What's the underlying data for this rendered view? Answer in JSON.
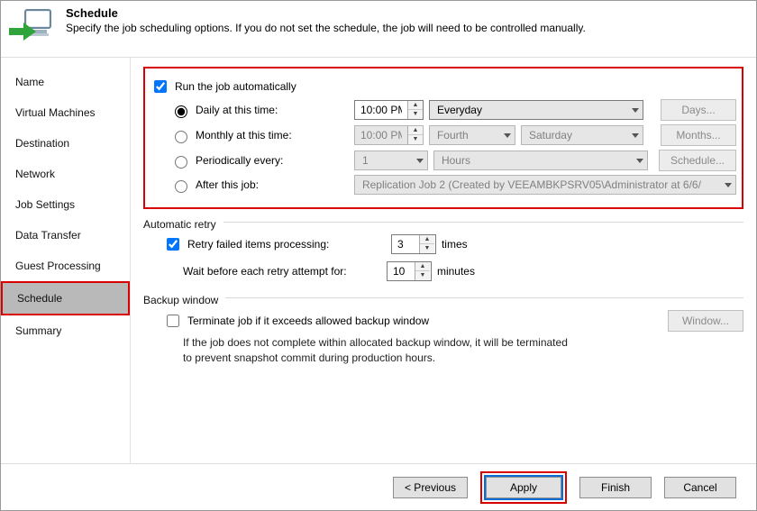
{
  "header": {
    "title": "Schedule",
    "subtitle": "Specify the job scheduling options. If you do not set the schedule, the job will need to be controlled manually."
  },
  "sidebar": {
    "items": [
      {
        "label": "Name"
      },
      {
        "label": "Virtual Machines"
      },
      {
        "label": "Destination"
      },
      {
        "label": "Network"
      },
      {
        "label": "Job Settings"
      },
      {
        "label": "Data Transfer"
      },
      {
        "label": "Guest Processing"
      },
      {
        "label": "Schedule"
      },
      {
        "label": "Summary"
      }
    ],
    "selected_index": 7
  },
  "main": {
    "run_auto_label": "Run the job automatically",
    "run_auto_checked": true,
    "daily_label": "Daily at this time:",
    "daily_selected": true,
    "daily_time": "10:00 PM",
    "daily_period": "Everyday",
    "days_btn": "Days...",
    "monthly_label": "Monthly at this time:",
    "monthly_time": "10:00 PM",
    "monthly_ord": "Fourth",
    "monthly_day": "Saturday",
    "months_btn": "Months...",
    "periodic_label": "Periodically every:",
    "periodic_n": "1",
    "periodic_unit": "Hours",
    "schedule_btn": "Schedule...",
    "after_label": "After this job:",
    "after_value": "Replication Job 2 (Created by VEEAMBKPSRV05\\Administrator at 6/6/",
    "retry_section": "Automatic retry",
    "retry_label": "Retry failed items processing:",
    "retry_checked": true,
    "retry_n": "3",
    "retry_times": "times",
    "wait_label": "Wait before each retry attempt for:",
    "wait_n": "10",
    "wait_unit": "minutes",
    "backup_section": "Backup window",
    "terminate_label": "Terminate job if it exceeds allowed backup window",
    "terminate_checked": false,
    "window_btn": "Window...",
    "note": "If the job does not complete within allocated backup window, it will be terminated to prevent snapshot commit during production hours."
  },
  "footer": {
    "previous": "< Previous",
    "apply": "Apply",
    "finish": "Finish",
    "cancel": "Cancel"
  }
}
